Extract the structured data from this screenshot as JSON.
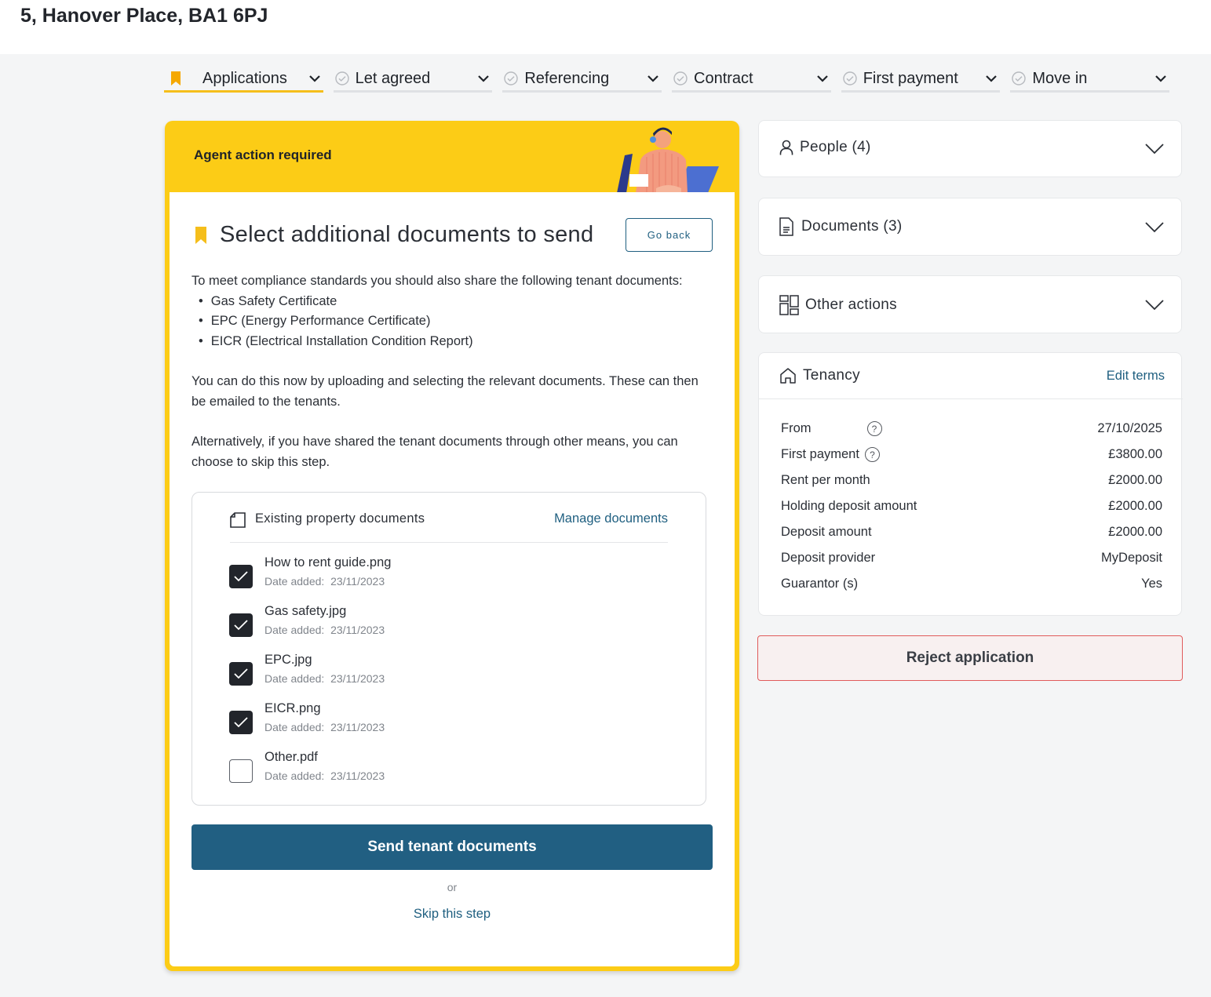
{
  "page": {
    "title": "5, Hanover Place, BA1 6PJ"
  },
  "steps": [
    {
      "label": "Applications",
      "active": true
    },
    {
      "label": "Let agreed",
      "active": false
    },
    {
      "label": "Referencing",
      "active": false
    },
    {
      "label": "Contract",
      "active": false
    },
    {
      "label": "First payment",
      "active": false
    },
    {
      "label": "Move in",
      "active": false
    }
  ],
  "action_card": {
    "banner": "Agent action required",
    "title": "Select additional documents to send",
    "go_back": "Go back",
    "intro": "To meet compliance standards you should also share the following tenant documents:",
    "bullets": [
      "Gas Safety Certificate",
      "EPC (Energy Performance Certificate)",
      "EICR (Electrical Installation Condition Report)"
    ],
    "para2": "You can do this now by uploading and selecting the relevant documents. These can then be emailed to the tenants.",
    "para3": "Alternatively, if you have shared the tenant documents through other means, you can choose to skip this step.",
    "docs_title": "Existing property documents",
    "manage_link": "Manage documents",
    "date_prefix": "Date added:",
    "documents": [
      {
        "name": "How to rent guide.png",
        "date": "23/11/2023",
        "checked": true
      },
      {
        "name": "Gas safety.jpg",
        "date": "23/11/2023",
        "checked": true
      },
      {
        "name": "EPC.jpg",
        "date": "23/11/2023",
        "checked": true
      },
      {
        "name": "EICR.png",
        "date": "23/11/2023",
        "checked": true
      },
      {
        "name": "Other.pdf",
        "date": "23/11/2023",
        "checked": false
      }
    ],
    "send_button": "Send tenant documents",
    "or": "or",
    "skip": "Skip this step"
  },
  "panels": {
    "people": "People (4)",
    "documents": "Documents (3)",
    "other_actions": "Other actions"
  },
  "tenancy": {
    "title": "Tenancy",
    "edit": "Edit terms",
    "rows": [
      {
        "label": "From",
        "value": "27/10/2025",
        "help": true
      },
      {
        "label": "First payment",
        "value": "£3800.00",
        "help": true
      },
      {
        "label": "Rent per month",
        "value": "£2000.00",
        "help": false
      },
      {
        "label": "Holding deposit amount",
        "value": "£2000.00",
        "help": false
      },
      {
        "label": "Deposit amount",
        "value": "£2000.00",
        "help": false
      },
      {
        "label": "Deposit provider",
        "value": "MyDeposit",
        "help": false
      },
      {
        "label": "Guarantor (s)",
        "value": "Yes",
        "help": false
      }
    ]
  },
  "reject_button": "Reject application",
  "colors": {
    "accent": "#fccc16",
    "primary": "#215f82",
    "danger": "#e05b5b"
  }
}
